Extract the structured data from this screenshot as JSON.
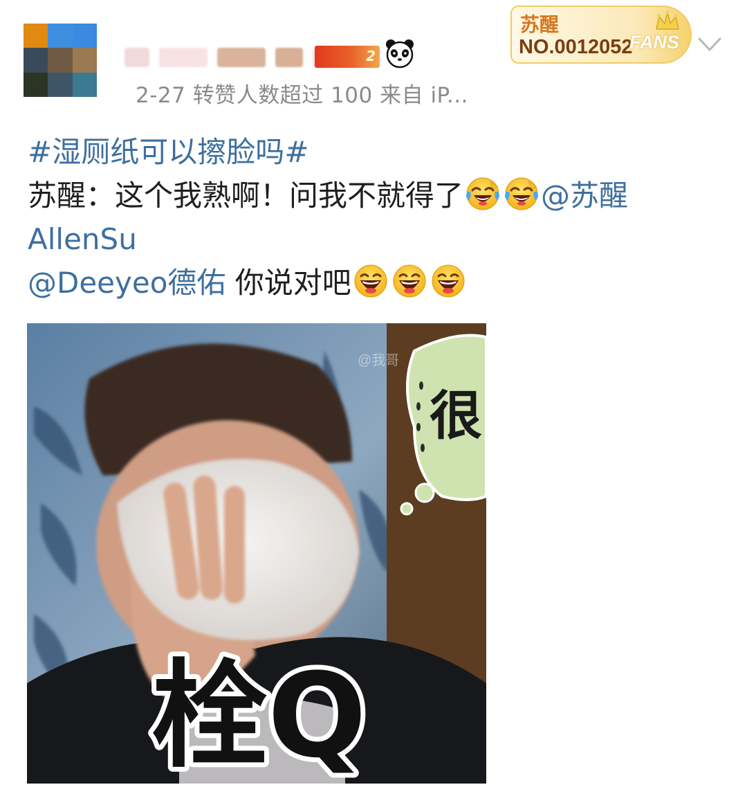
{
  "post": {
    "meta": "2-27  转赞人数超过 100   来自 iP...",
    "fans_badge": {
      "name": "苏醒",
      "number": "NO.0012052",
      "label": "FANS"
    },
    "vip_badge_text": "2",
    "topic": "#湿厕纸可以擦脸吗#",
    "line1_text": "苏醒：这个我熟啊！问我不就得了",
    "mention1_part1": "@苏醒",
    "mention1_part2": "AllenSu",
    "mention2": "@Deeyeo德佑",
    "line3_text": " 你说对吧",
    "emojis": {
      "laugh_cry": "laugh-cry-emoji",
      "laugh": "laugh-emoji"
    }
  },
  "image": {
    "bubble_text": "很",
    "caption": "栓Q",
    "watermark": "@我哥"
  },
  "icons": {
    "panda": "panda-icon",
    "crown": "crown-icon",
    "chevron": "chevron-down-icon"
  },
  "colors": {
    "link": "#3e6f9e",
    "meta": "#8a8a8a",
    "fans_gold": "#f2cb62"
  }
}
